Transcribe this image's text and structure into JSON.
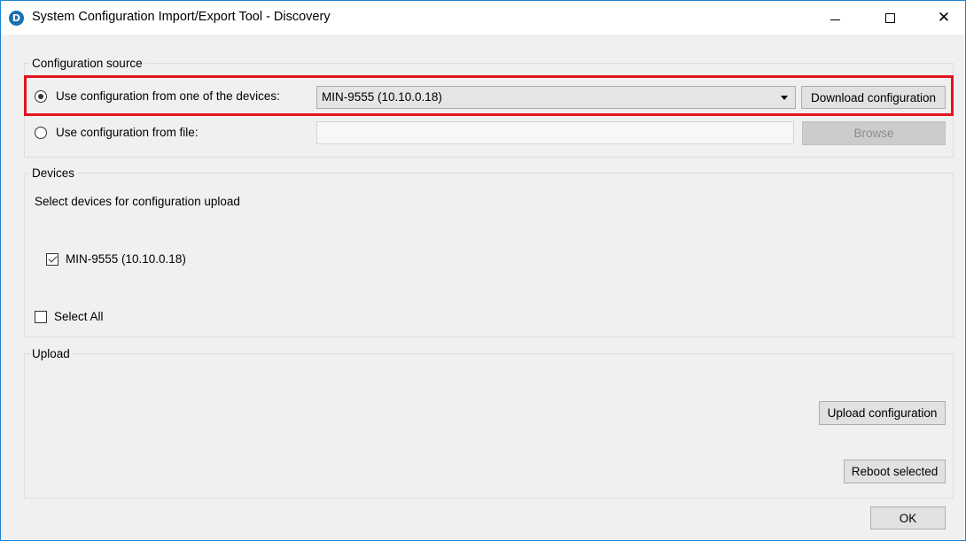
{
  "window": {
    "title": "System Configuration Import/Export Tool - Discovery",
    "app_icon_letter": "D",
    "controls": {
      "minimize": "—",
      "maximize": "☐",
      "close": "✕"
    },
    "accent_color": "#1883d7"
  },
  "config_source": {
    "legend": "Configuration source",
    "device_option_label": "Use configuration from one of the devices:",
    "device_option_selected": true,
    "device_select_value": "MIN-9555 (10.10.0.18)",
    "download_button": "Download configuration",
    "file_option_label": "Use configuration from file:",
    "file_option_selected": false,
    "file_path_value": "",
    "browse_button": "Browse"
  },
  "devices": {
    "legend": "Devices",
    "instruction": "Select devices for configuration upload",
    "items": [
      {
        "label": "MIN-9555 (10.10.0.18)",
        "checked": true
      }
    ],
    "select_all_label": "Select All",
    "select_all_checked": false
  },
  "upload": {
    "legend": "Upload",
    "upload_button": "Upload configuration",
    "reboot_button": "Reboot selected"
  },
  "footer": {
    "ok_button": "OK"
  },
  "highlight_color": "#e2141e"
}
